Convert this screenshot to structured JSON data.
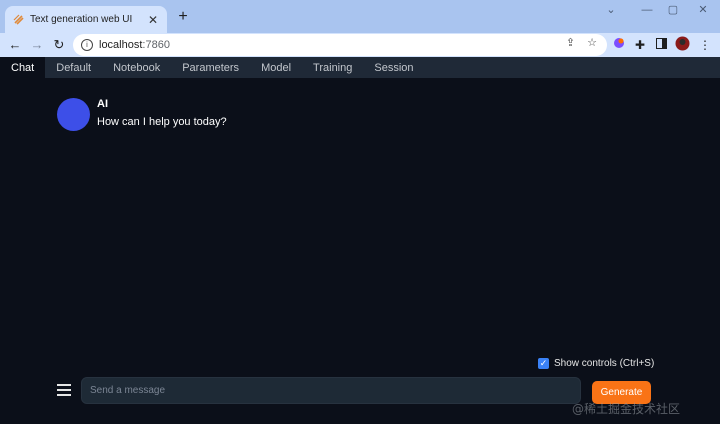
{
  "browser": {
    "tab_title": "Text generation web UI",
    "tab_close": "✕",
    "new_tab": "+",
    "url_host": "localhost",
    "url_port": ":7860",
    "window_controls": [
      "⌄",
      "—",
      "▢",
      "✕"
    ]
  },
  "app": {
    "tabs": [
      {
        "label": "Chat",
        "active": true
      },
      {
        "label": "Default"
      },
      {
        "label": "Notebook"
      },
      {
        "label": "Parameters"
      },
      {
        "label": "Model"
      },
      {
        "label": "Training"
      },
      {
        "label": "Session"
      }
    ],
    "message": {
      "sender": "AI",
      "text": "How can I help you today?",
      "avatar_color": "#3d4fe8"
    },
    "show_controls": {
      "label": "Show controls (Ctrl+S)",
      "checked": true
    },
    "input": {
      "placeholder": "Send a message"
    },
    "generate_label": "Generate",
    "accent_color": "#f97316"
  },
  "watermark": "@稀土掘金技术社区"
}
